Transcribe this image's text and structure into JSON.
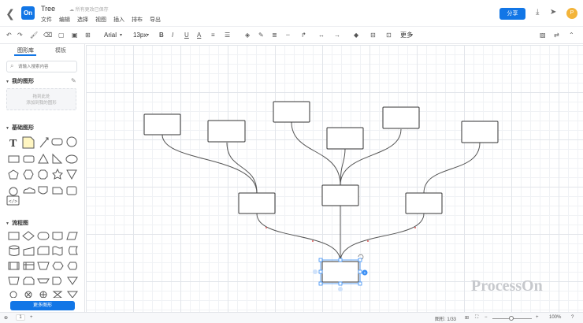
{
  "header": {
    "back_icon": "chevron-left-icon",
    "logo_text": "On",
    "title": "Tree",
    "save_status": "所有更改已保存",
    "menu": [
      "文件",
      "编辑",
      "选择",
      "视图",
      "插入",
      "排布",
      "导出"
    ],
    "share_label": "分享",
    "avatar_initial": "P",
    "brand_color": "#1276e6"
  },
  "toolbar": {
    "font_family": "Arial",
    "font_size": "13px",
    "more_label": "更多"
  },
  "left_panel": {
    "tabs": [
      "图形库",
      "模板"
    ],
    "search_placeholder": "请输入搜索内容",
    "my_shapes": {
      "title": "我的图形",
      "drop_line1": "拖到此处",
      "drop_line2": "添加到我的图形"
    },
    "basic_shapes_title": "基础图形",
    "flowchart_title": "流程图",
    "more_shapes_label": "更多图形"
  },
  "canvas": {
    "watermark": "ProcessOn"
  },
  "status_bar": {
    "page_number": "1",
    "shape_count": "图形: 1/33",
    "zoom": "100%"
  }
}
